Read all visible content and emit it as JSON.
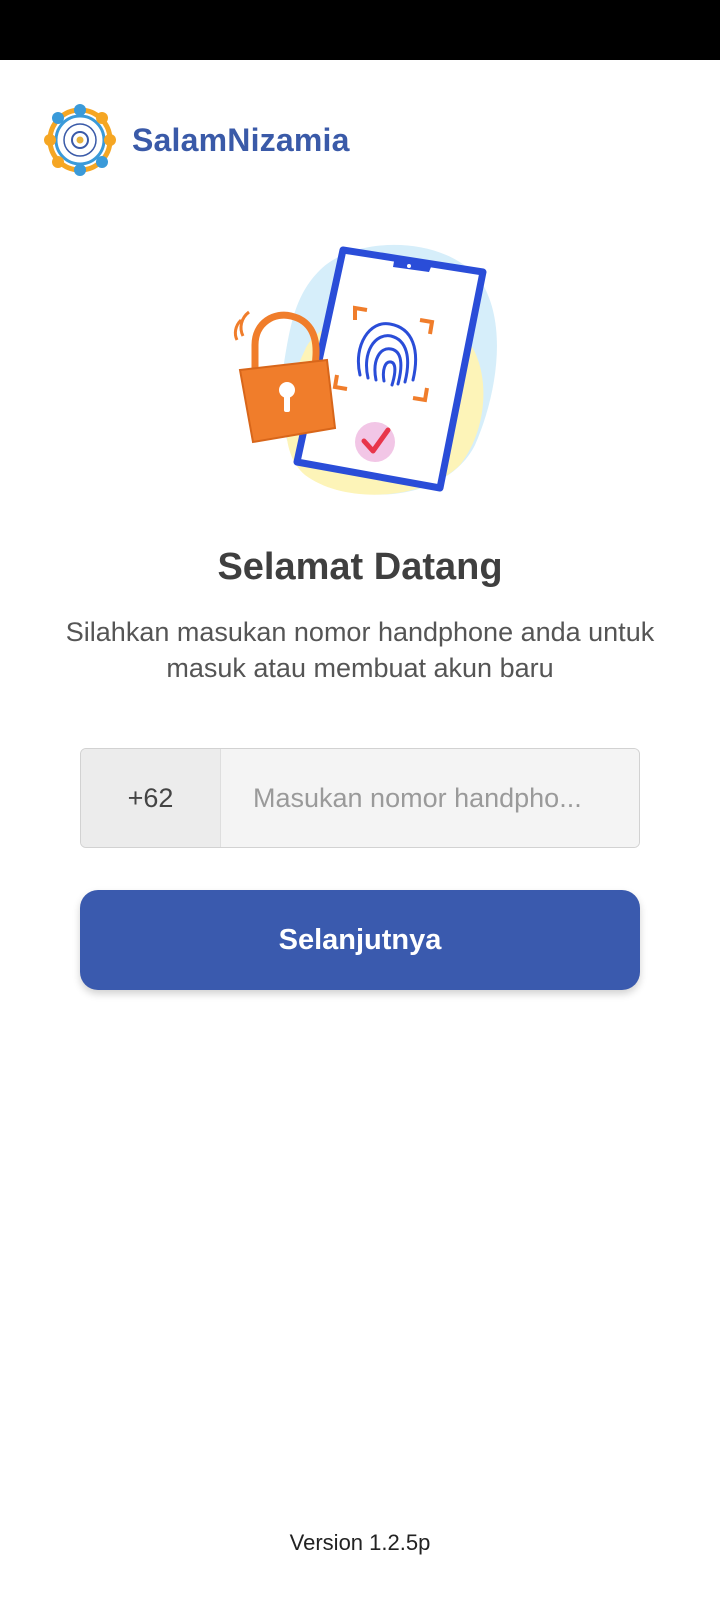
{
  "app": {
    "name": "SalamNizamia",
    "logo_icon": "salamnizamia-logo-icon"
  },
  "hero": {
    "icons": [
      "padlock-icon",
      "phone-fingerprint-icon",
      "checkmark-icon"
    ]
  },
  "welcome": {
    "title": "Selamat Datang",
    "subtitle": "Silahkan masukan nomor handphone anda untuk masuk atau membuat akun baru"
  },
  "phone_form": {
    "country_code": "+62",
    "value": "",
    "placeholder": "Masukan nomor handpho..."
  },
  "next_button": {
    "label": "Selanjutnya"
  },
  "footer": {
    "version": "Version 1.2.5p"
  },
  "colors": {
    "brand": "#3a5aa8",
    "button": "#3a5aae",
    "status_bar": "#000000"
  }
}
